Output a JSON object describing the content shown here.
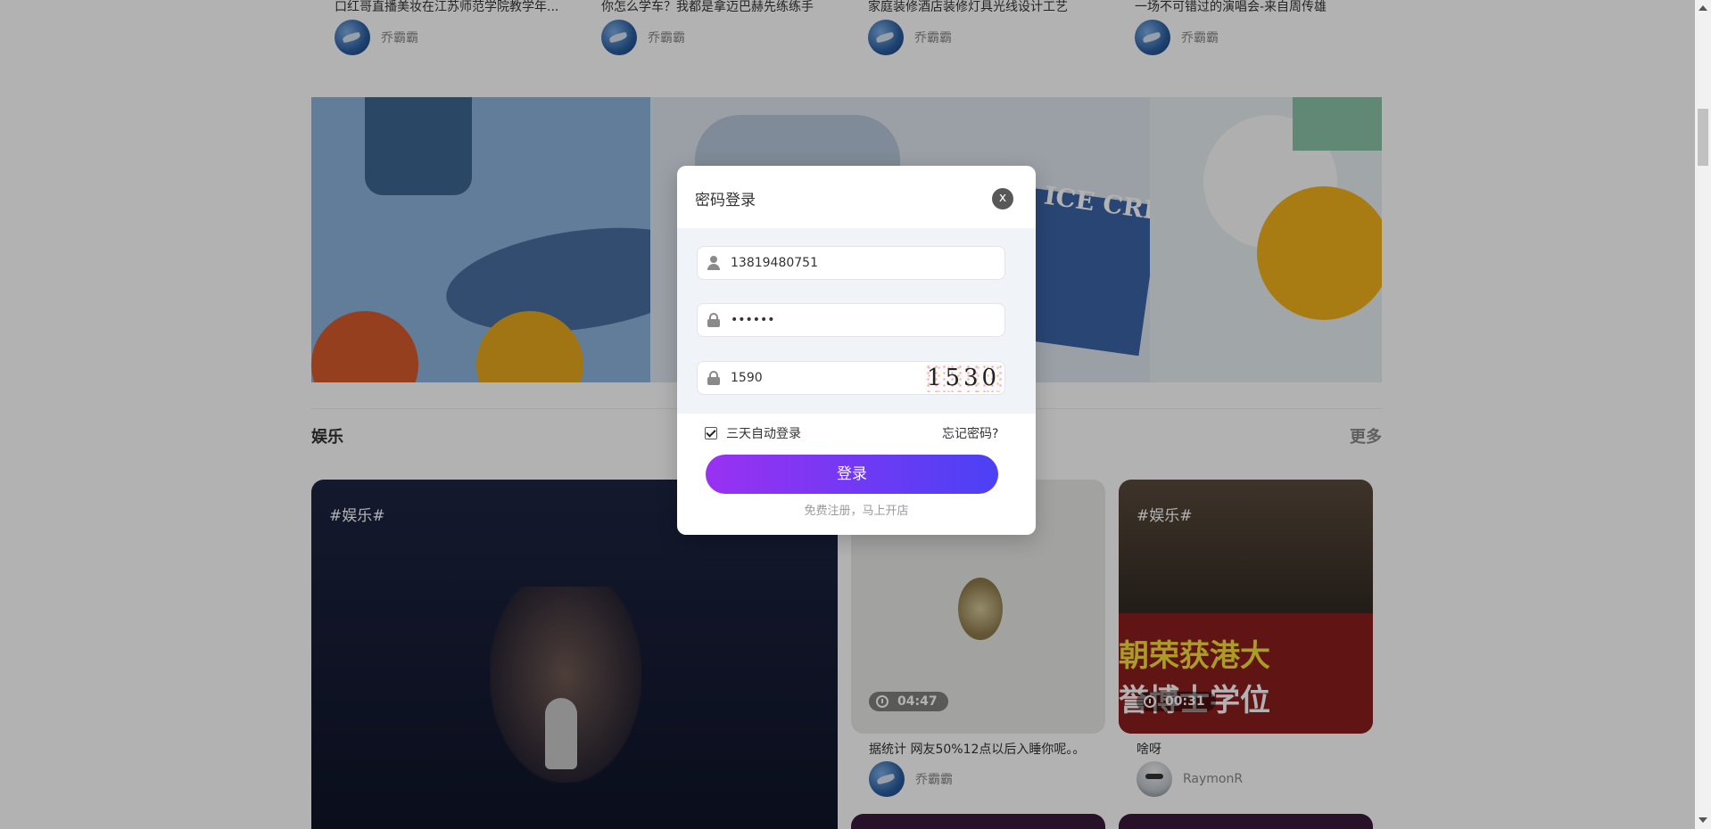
{
  "top_articles": [
    {
      "title": "口红哥直播美妆在江苏师范学院教学年...",
      "author": "乔霸霸"
    },
    {
      "title": "你怎么学车？我都是拿迈巴赫先练练手",
      "author": "乔霸霸"
    },
    {
      "title": "家庭装修酒店装修灯具光线设计工艺",
      "author": "乔霸霸"
    },
    {
      "title": "一场不可错过的演唱会-来自周传雄",
      "author": "乔霸霸"
    }
  ],
  "banner": {
    "art_text": "ICE CREAM & coffee"
  },
  "section": {
    "title": "娱乐",
    "more": "更多"
  },
  "videos": [
    {
      "tag": "#娱乐#"
    },
    {
      "tag": "",
      "duration": "04:47",
      "title": "据统计 网友50%12点以后入睡你呢。。",
      "author": "乔霸霸"
    },
    {
      "tag": "#娱乐#",
      "duration": "00:31",
      "caption1": "朝荣获港大",
      "caption2": "誉博士学位",
      "title": "啥呀",
      "author": "RaymonR"
    }
  ],
  "login_modal": {
    "title": "密码登录",
    "close_label": "x",
    "phone_value": "13819480751",
    "password_value": "••••••",
    "captcha_value": "1590",
    "captcha_image_text": "1530",
    "remember_label": "三天自动登录",
    "remember_checked": true,
    "forgot_label": "忘记密码?",
    "login_label": "登录",
    "register_label": "免费注册，马上开店"
  },
  "colors": {
    "button_gradient_start": "#9a31f2",
    "button_gradient_end": "#4b41f5",
    "overlay": "rgba(0,0,0,0.3)"
  },
  "icons": {
    "phone": "user-icon",
    "password": "lock-icon",
    "captcha": "lock-icon",
    "close": "close-icon",
    "duration": "clock-icon"
  }
}
